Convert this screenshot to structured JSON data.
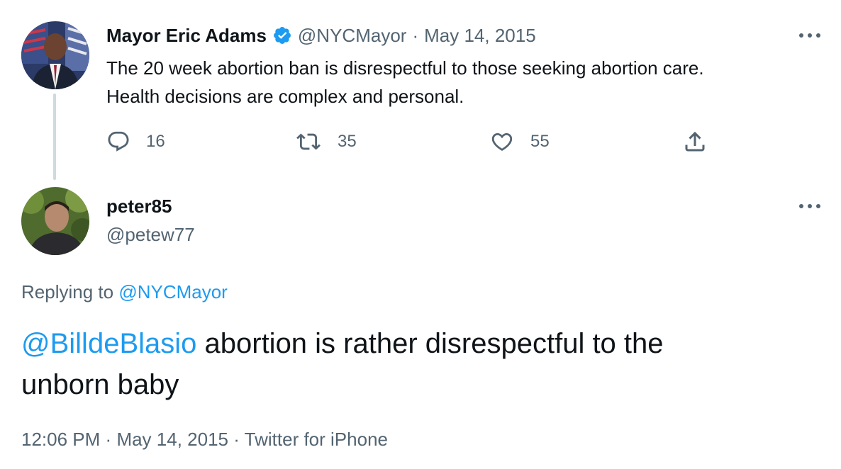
{
  "original_tweet": {
    "display_name": "Mayor Eric Adams",
    "verified_icon": "verified-badge-icon",
    "handle": "@NYCMayor",
    "separator": "·",
    "date": "May 14, 2015",
    "text_line1": "The 20 week abortion ban is disrespectful to those seeking abortion care.",
    "text_line2": "Health decisions are complex and personal.",
    "actions": {
      "reply_count": "16",
      "retweet_count": "35",
      "like_count": "55"
    }
  },
  "reply_tweet": {
    "display_name": "peter85",
    "handle": "@petew77",
    "replying_to_label": "Replying to",
    "replying_to_handle": "@NYCMayor",
    "mention": "@BilldeBlasio",
    "text_rest_line1": " abortion is rather disrespectful to the",
    "text_line2": "unborn baby",
    "footer": {
      "time": "12:06 PM",
      "sep1": "·",
      "date": "May 14, 2015",
      "sep2": "·",
      "source": "Twitter for iPhone"
    }
  },
  "colors": {
    "accent": "#1d9bf0",
    "text": "#0f1419",
    "muted": "#536471",
    "thread_line": "#cfd9de"
  }
}
